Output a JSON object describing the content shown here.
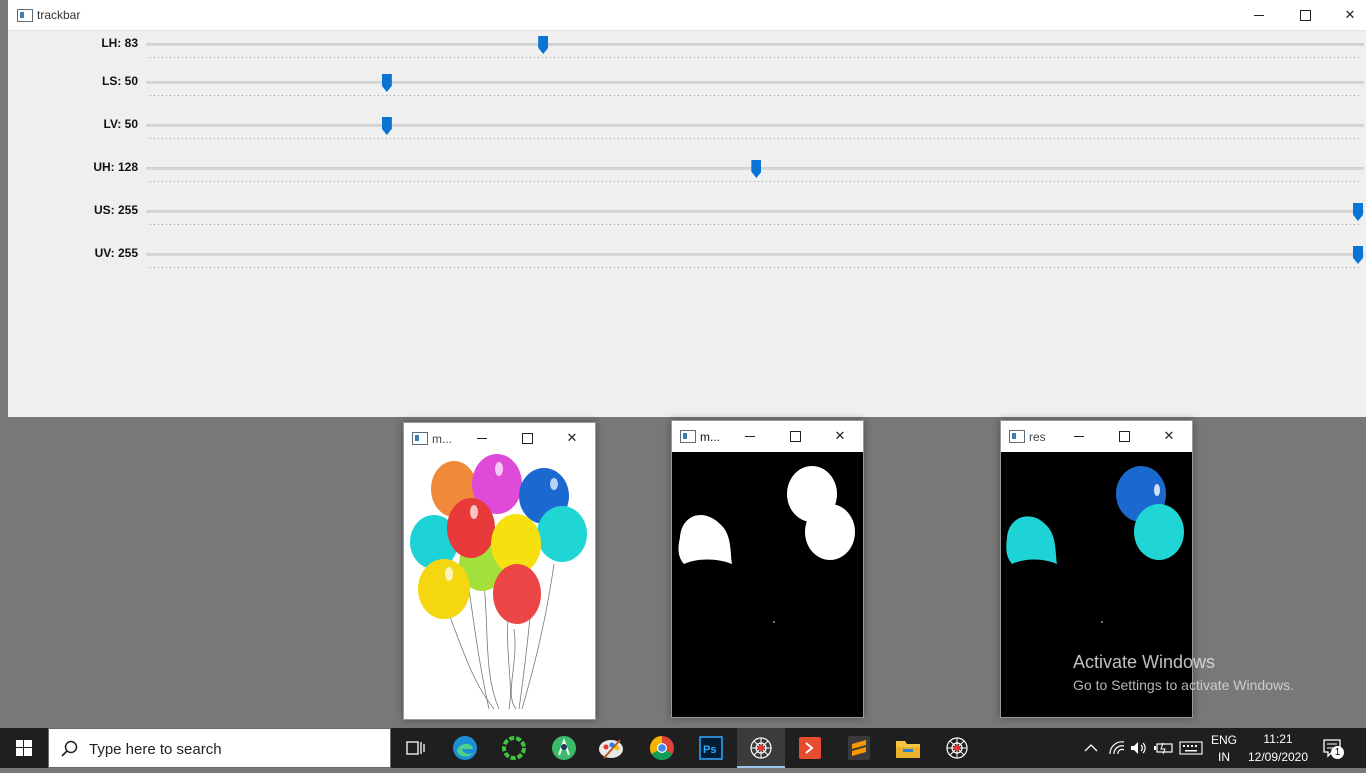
{
  "trackbar_window": {
    "title": "trackbar",
    "sliders": [
      {
        "label": "LH: 83",
        "value": 83,
        "max": 255
      },
      {
        "label": "LS: 50",
        "value": 50,
        "max": 255
      },
      {
        "label": "LV: 50",
        "value": 50,
        "max": 255
      },
      {
        "label": "UH: 128",
        "value": 128,
        "max": 255
      },
      {
        "label": "US: 255",
        "value": 255,
        "max": 255
      },
      {
        "label": "UV: 255",
        "value": 255,
        "max": 255
      }
    ]
  },
  "image_windows": [
    {
      "title": "m...",
      "content": "original balloons image"
    },
    {
      "title": "m...",
      "content": "binary mask"
    },
    {
      "title": "res",
      "content": "masked result"
    }
  ],
  "watermark": {
    "title": "Activate Windows",
    "subtitle": "Go to Settings to activate Windows."
  },
  "taskbar": {
    "search_placeholder": "Type here to search",
    "apps": [
      "task-view-icon",
      "edge-icon",
      "circular-app-icon",
      "android-studio-icon",
      "paint-icon",
      "chrome-icon",
      "photoshop-icon",
      "opencv-spider-icon",
      "git-icon",
      "sublime-icon",
      "file-explorer-icon",
      "opencv-spider-icon"
    ],
    "lang_line1": "ENG",
    "lang_line2": "IN",
    "time": "11:21",
    "date": "12/09/2020",
    "notification_count": "1"
  },
  "colors": {
    "slider_thumb": "#0a74d4",
    "window_bg": "#efefef",
    "desktop_bg": "#787878",
    "taskbar_bg": "#1f1f1f"
  }
}
